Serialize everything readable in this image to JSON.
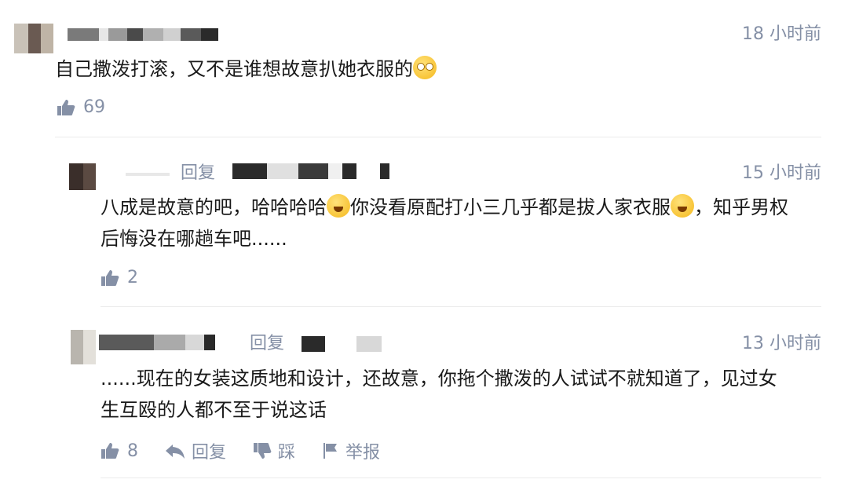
{
  "comments": [
    {
      "time": "18 小时前",
      "text": "自己撒泼打滚，又不是谁想故意扒她衣服的",
      "emoji": "rolling-eyes",
      "likes": "69"
    },
    {
      "reply_label": "回复",
      "time": "15 小时前",
      "text_a": "八成是故意的吧，哈哈哈哈",
      "text_b": "你没看原配打小三几乎都是拔人家衣服",
      "text_c": "，知乎男权",
      "text_line2": "后悔没在哪趟车吧......",
      "emoji": "tears-of-joy",
      "likes": "2"
    },
    {
      "reply_label": "回复",
      "time": "13 小时前",
      "text_line1": "......现在的女装这质地和设计，还故意，你拖个撒泼的人试试不就知道了，见过女",
      "text_line2": "生互殴的人都不至于说这话",
      "likes": "8",
      "actions": {
        "reply": "回复",
        "dislike": "踩",
        "report": "举报"
      }
    }
  ],
  "colors": {
    "meta": "#8590a6",
    "text": "#1a1a1a",
    "divider": "#ebebeb"
  }
}
